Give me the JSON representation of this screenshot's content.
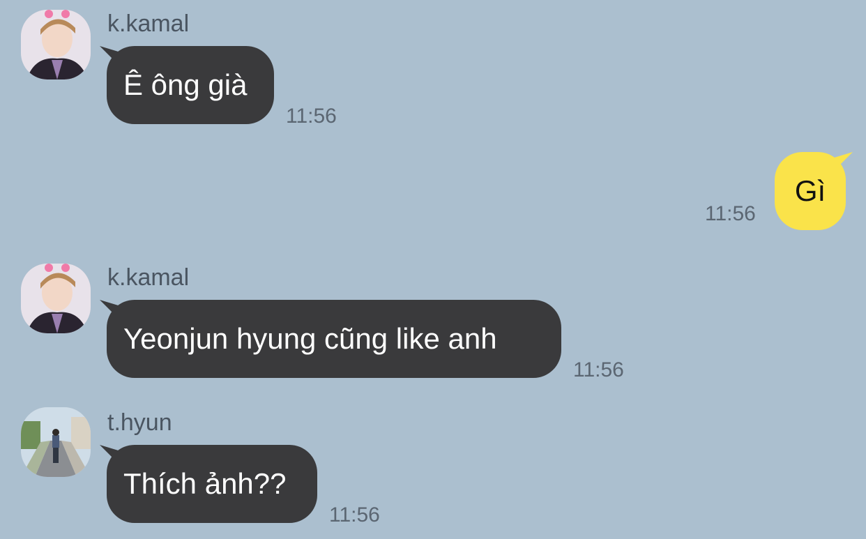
{
  "messages": [
    {
      "sender": "k.kamal",
      "text": "Ê ông già",
      "time": "11:56"
    },
    {
      "text": "Gì",
      "time": "11:56"
    },
    {
      "sender": "k.kamal",
      "text": "Yeonjun hyung cũng like anh",
      "time": "11:56"
    },
    {
      "sender": "t.hyun",
      "text": "Thích ảnh??",
      "time": "11:56"
    }
  ],
  "colors": {
    "background": "#abbfcf",
    "incoming_bubble": "#3a3a3c",
    "outgoing_bubble": "#fae34a",
    "timestamp": "#5b6672",
    "sender_name": "#4a5561"
  }
}
